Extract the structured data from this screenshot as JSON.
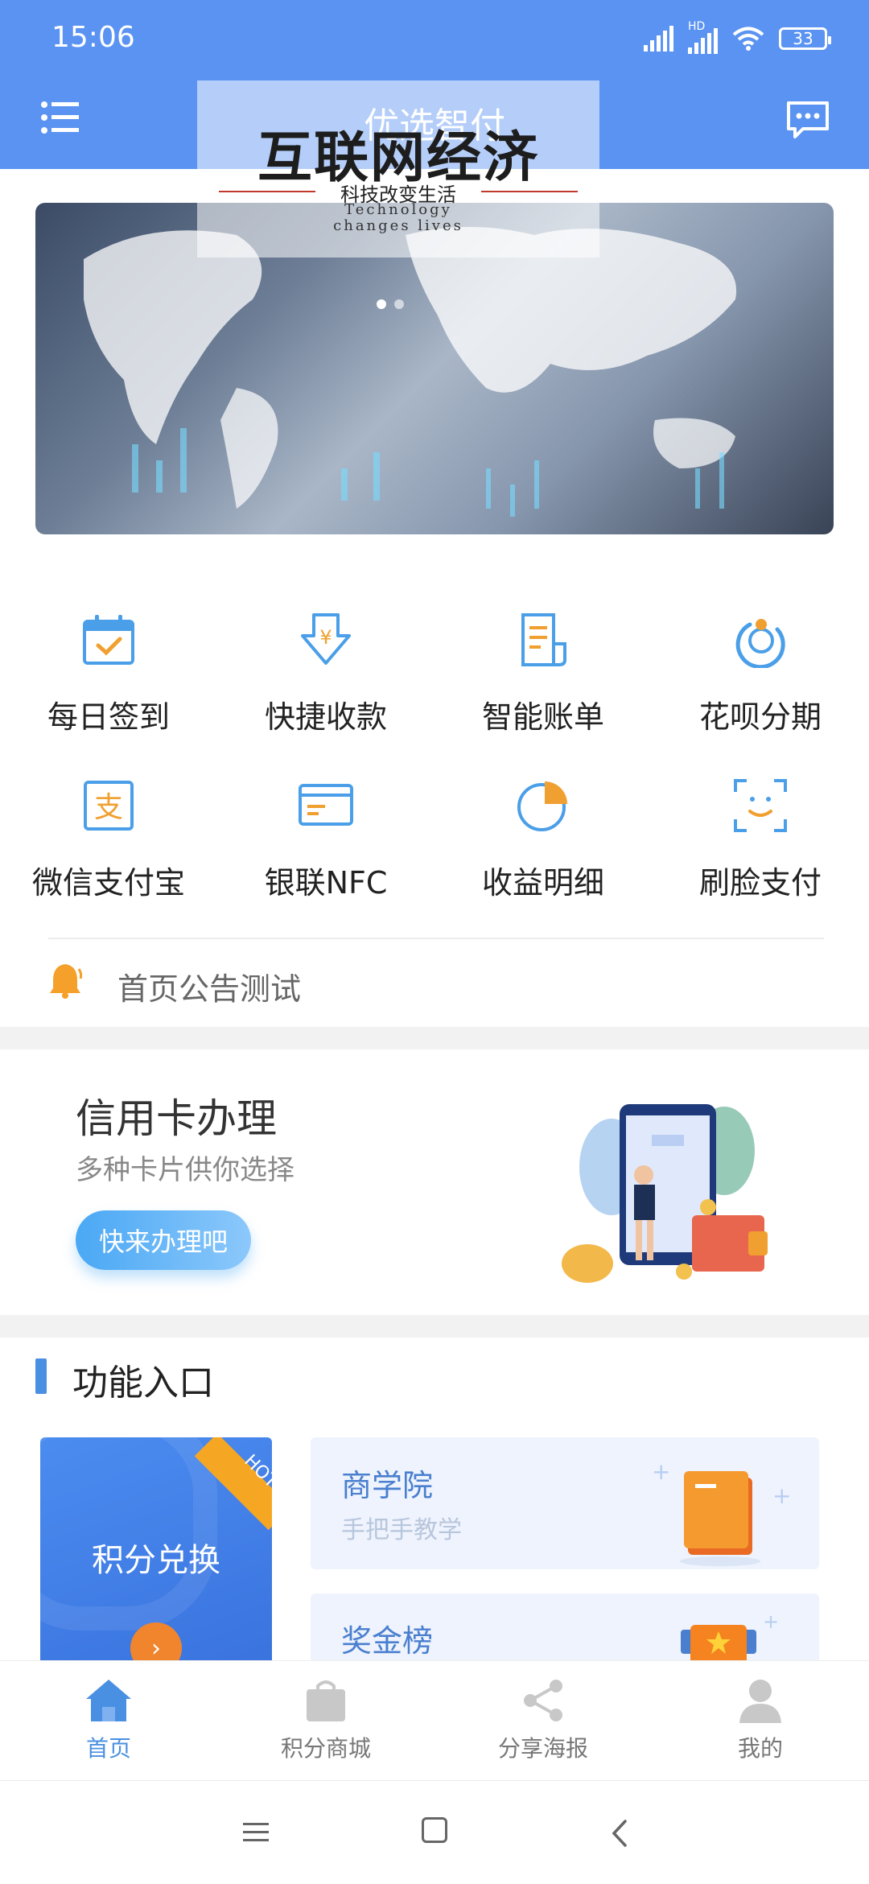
{
  "status_bar": {
    "time": "15:06",
    "hd": "HD",
    "battery": "33"
  },
  "header": {
    "title": "优选智付"
  },
  "banner": {
    "title": "互联网经济",
    "subtitle": "科技改变生活",
    "english_line1": "Technology",
    "english_line2": "changes lives"
  },
  "grid": [
    {
      "label": "每日签到",
      "icon": "calendar-check-icon"
    },
    {
      "label": "快捷收款",
      "icon": "yuan-download-icon"
    },
    {
      "label": "智能账单",
      "icon": "bill-icon"
    },
    {
      "label": "花呗分期",
      "icon": "huabei-icon"
    },
    {
      "label": "微信支付宝",
      "icon": "alipay-icon"
    },
    {
      "label": "银联NFC",
      "icon": "bank-card-icon"
    },
    {
      "label": "收益明细",
      "icon": "pie-chart-icon"
    },
    {
      "label": "刷脸支付",
      "icon": "face-scan-icon"
    }
  ],
  "notice": {
    "text": "首页公告测试",
    "icon": "bell-icon"
  },
  "credit_card": {
    "title": "信用卡办理",
    "subtitle": "多种卡片供你选择",
    "button": "快来办理吧"
  },
  "functions": {
    "title": "功能入口",
    "points": {
      "label": "积分兑换",
      "badge": "HOT"
    },
    "school": {
      "title": "商学院",
      "subtitle": "手把手教学"
    },
    "bonus": {
      "title": "奖金榜"
    }
  },
  "tabs": [
    {
      "label": "首页",
      "icon": "home-icon",
      "active": true
    },
    {
      "label": "积分商城",
      "icon": "shopping-bag-icon",
      "active": false
    },
    {
      "label": "分享海报",
      "icon": "share-icon",
      "active": false
    },
    {
      "label": "我的",
      "icon": "user-icon",
      "active": false
    }
  ],
  "colors": {
    "primary": "#5a93f2",
    "accent_orange": "#f5a623",
    "icon_blue": "#4a9fe8"
  }
}
